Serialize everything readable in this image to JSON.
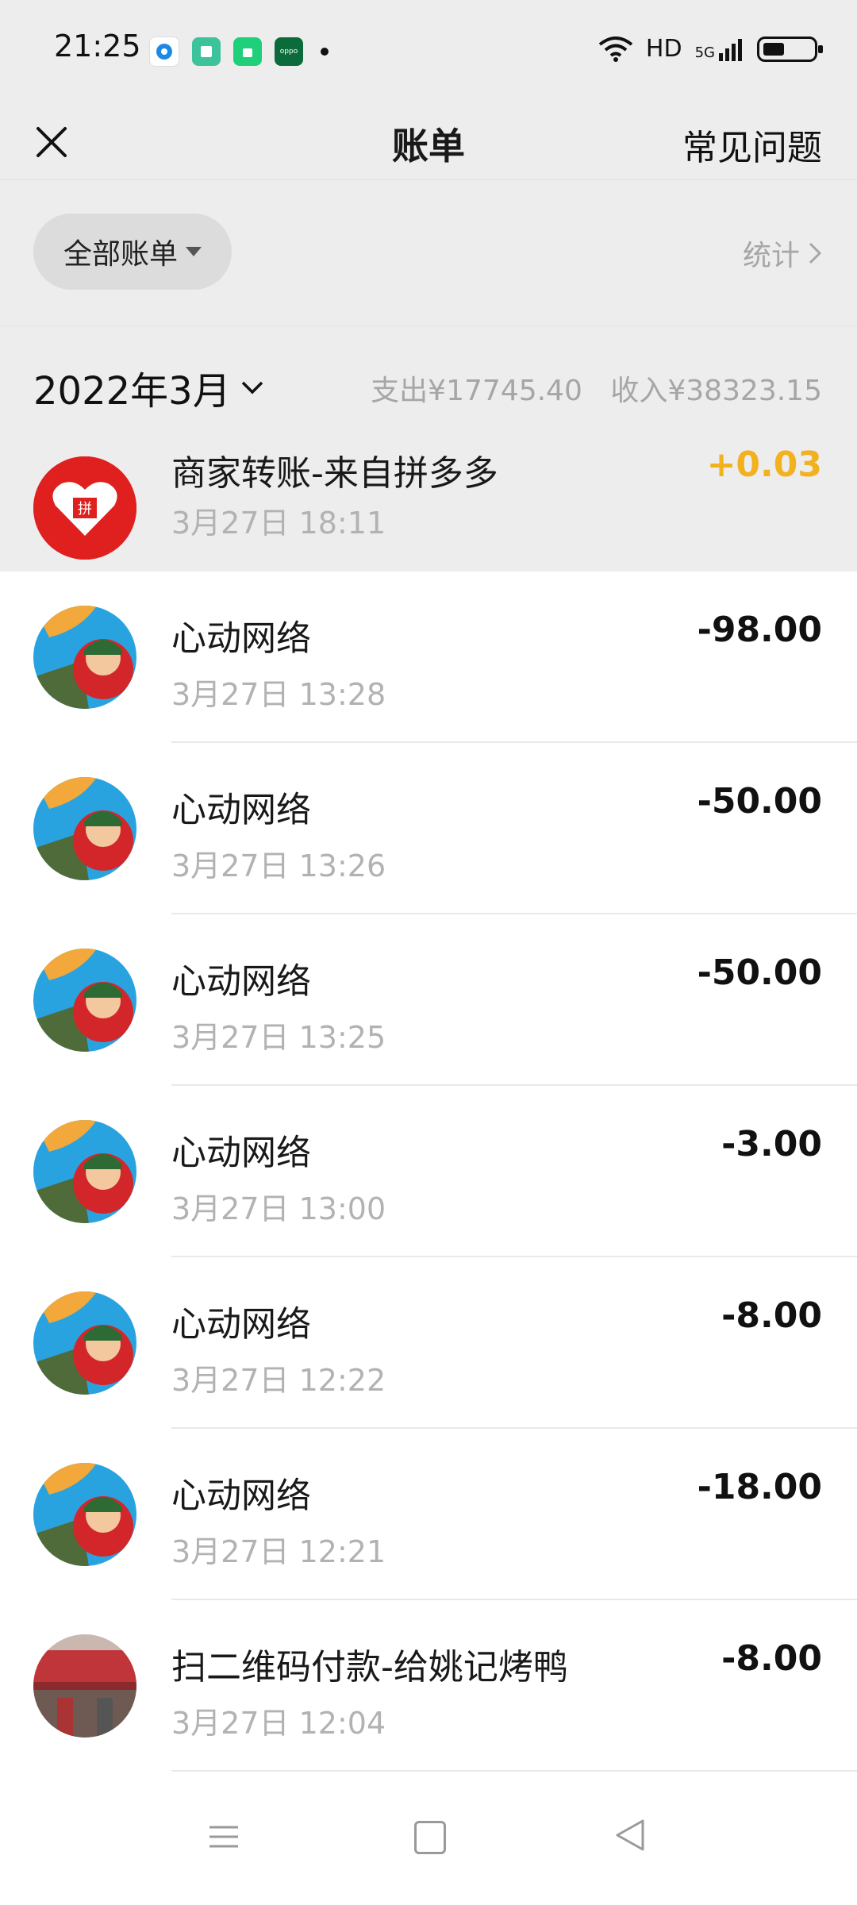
{
  "status_bar": {
    "time": "21:25",
    "network": "HD",
    "signal": "5G"
  },
  "nav": {
    "title": "账单",
    "faq": "常见问题"
  },
  "filter": {
    "all_bills": "全部账单",
    "stats": "统计"
  },
  "month": {
    "label": "2022年3月",
    "expense": "支出¥17745.40",
    "income": "收入¥38323.15"
  },
  "transactions": [
    {
      "title": "商家转账-来自拼多多",
      "date": "3月27日 18:11",
      "amount": "+0.03",
      "avatar": "pinduoduo-logo"
    },
    {
      "title": "心动网络",
      "date": "3月27日 13:28",
      "amount": "-98.00",
      "avatar": "game-avatar"
    },
    {
      "title": "心动网络",
      "date": "3月27日 13:26",
      "amount": "-50.00",
      "avatar": "game-avatar"
    },
    {
      "title": "心动网络",
      "date": "3月27日 13:25",
      "amount": "-50.00",
      "avatar": "game-avatar"
    },
    {
      "title": "心动网络",
      "date": "3月27日 13:00",
      "amount": "-3.00",
      "avatar": "game-avatar"
    },
    {
      "title": "心动网络",
      "date": "3月27日 12:22",
      "amount": "-8.00",
      "avatar": "game-avatar"
    },
    {
      "title": "心动网络",
      "date": "3月27日 12:21",
      "amount": "-18.00",
      "avatar": "game-avatar"
    },
    {
      "title": "扫二维码付款-给姚记烤鸭",
      "date": "3月27日 12:04",
      "amount": "-8.00",
      "avatar": "shop-avatar"
    }
  ],
  "colors": {
    "income": "#f2b11e",
    "background_gray": "#ededed",
    "secondary_text": "#b2b2b2"
  }
}
